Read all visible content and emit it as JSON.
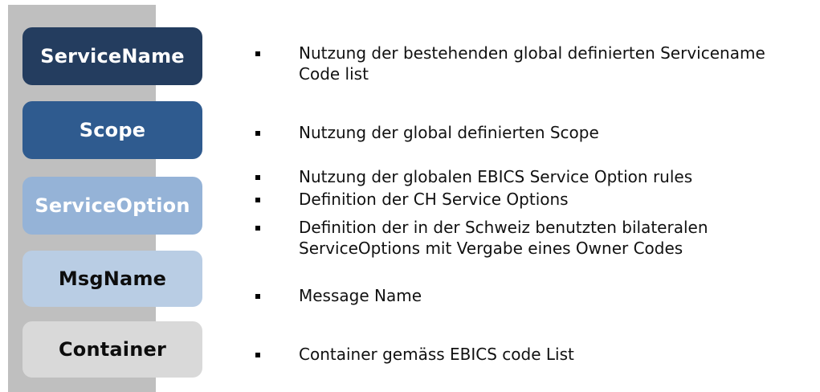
{
  "boxes": [
    {
      "label": "ServiceName",
      "bg": "#243d5f",
      "fg": "#ffffff"
    },
    {
      "label": "Scope",
      "bg": "#2f5b8f",
      "fg": "#ffffff"
    },
    {
      "label": "ServiceOption",
      "bg": "#95b3d7",
      "fg": "#ffffff"
    },
    {
      "label": "MsgName",
      "bg": "#b9cde4",
      "fg": "#0d0d0d"
    },
    {
      "label": "Container",
      "bg": "#d9d9d9",
      "fg": "#0d0d0d"
    }
  ],
  "bullets": [
    "Nutzung der bestehenden global definierten Servicename\nCode list",
    "Nutzung der global definierten Scope",
    "Nutzung der globalen EBICS Service Option rules",
    "Definition der CH Service Options",
    "Definition der in der Schweiz benutzten bilateralen\nServiceOptions mit Vergabe eines Owner Codes",
    "Message Name",
    "Container gemäss EBICS code List"
  ]
}
